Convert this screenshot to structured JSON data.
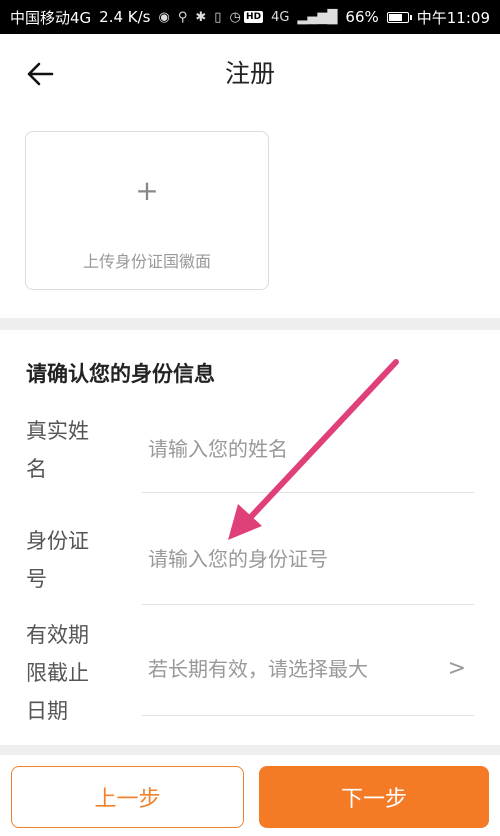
{
  "status_bar": {
    "carrier": "中国移动4G",
    "speed": "2.4 K/s",
    "hd": "HD",
    "network": "4G",
    "battery": "66%",
    "battery_level": 0.66,
    "time": "中午11:09"
  },
  "header": {
    "title": "注册",
    "back_icon": "arrow-left-icon"
  },
  "upload": {
    "plus": "+",
    "label": "上传身份证国徽面"
  },
  "identity": {
    "section_title": "请确认您的身份信息",
    "fields": [
      {
        "label": "真实姓名",
        "placeholder": "请输入您的姓名"
      },
      {
        "label": "身份证号",
        "placeholder": "请输入您的身份证号"
      },
      {
        "label": "有效期限截止日期",
        "placeholder": "若长期有效，请选择最大",
        "chevron": ">"
      }
    ]
  },
  "buttons": {
    "prev": "上一步",
    "next": "下一步"
  },
  "colors": {
    "accent": "#f47a26",
    "annotation_arrow": "#e0407a"
  }
}
